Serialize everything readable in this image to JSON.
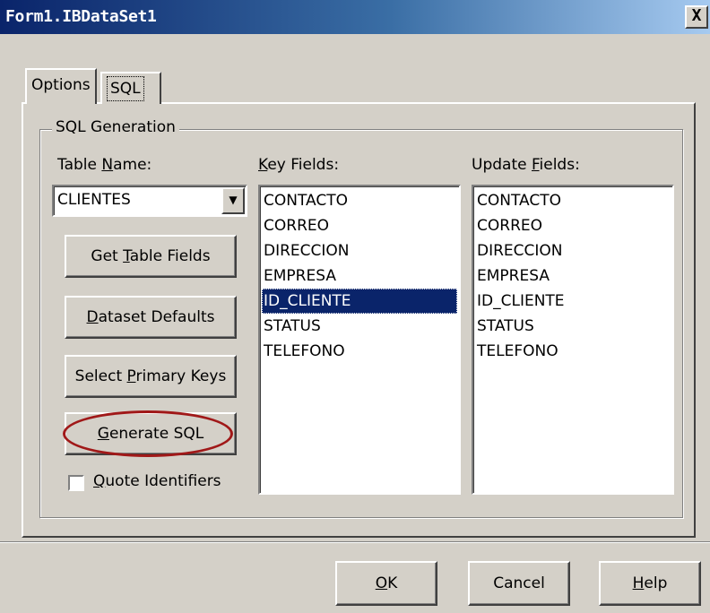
{
  "window": {
    "title": "Form1.IBDataSet1",
    "close_label": "X"
  },
  "tabs": [
    {
      "label": "Options",
      "selected": true
    },
    {
      "label": "SQL",
      "selected": false
    }
  ],
  "group": {
    "title": "SQL Generation"
  },
  "table_name": {
    "label_pre": "Table ",
    "label_accel": "N",
    "label_post": "ame:",
    "value": "CLIENTES"
  },
  "buttons": {
    "get_table_fields": {
      "pre": "Get ",
      "accel": "T",
      "post": "able Fields"
    },
    "dataset_defaults": {
      "pre": "",
      "accel": "D",
      "post": "ataset Defaults"
    },
    "select_primary_keys": {
      "pre": "Select ",
      "accel": "P",
      "post": "rimary Keys"
    },
    "generate_sql": {
      "pre": "",
      "accel": "G",
      "post": "enerate SQL"
    }
  },
  "quote_identifiers": {
    "pre": "",
    "accel": "Q",
    "post": "uote Identifiers",
    "checked": false
  },
  "key_fields": {
    "label_pre": "",
    "label_accel": "K",
    "label_post": "ey Fields:",
    "items": [
      "CONTACTO",
      "CORREO",
      "DIRECCION",
      "EMPRESA",
      "ID_CLIENTE",
      "STATUS",
      "TELEFONO"
    ],
    "selected": "ID_CLIENTE"
  },
  "update_fields": {
    "label_pre": "Update ",
    "label_accel": "F",
    "label_post": "ields:",
    "items": [
      "CONTACTO",
      "CORREO",
      "DIRECCION",
      "EMPRESA",
      "ID_CLIENTE",
      "STATUS",
      "TELEFONO"
    ]
  },
  "footer": {
    "ok": {
      "pre": "",
      "accel": "O",
      "post": "K"
    },
    "cancel": "Cancel",
    "help": {
      "pre": "",
      "accel": "H",
      "post": "elp"
    }
  },
  "colors": {
    "title_start": "#0a246a",
    "title_end": "#a6caf0",
    "face": "#d4d0c8",
    "selection": "#0a246a",
    "highlight_ellipse": "#a01818"
  }
}
